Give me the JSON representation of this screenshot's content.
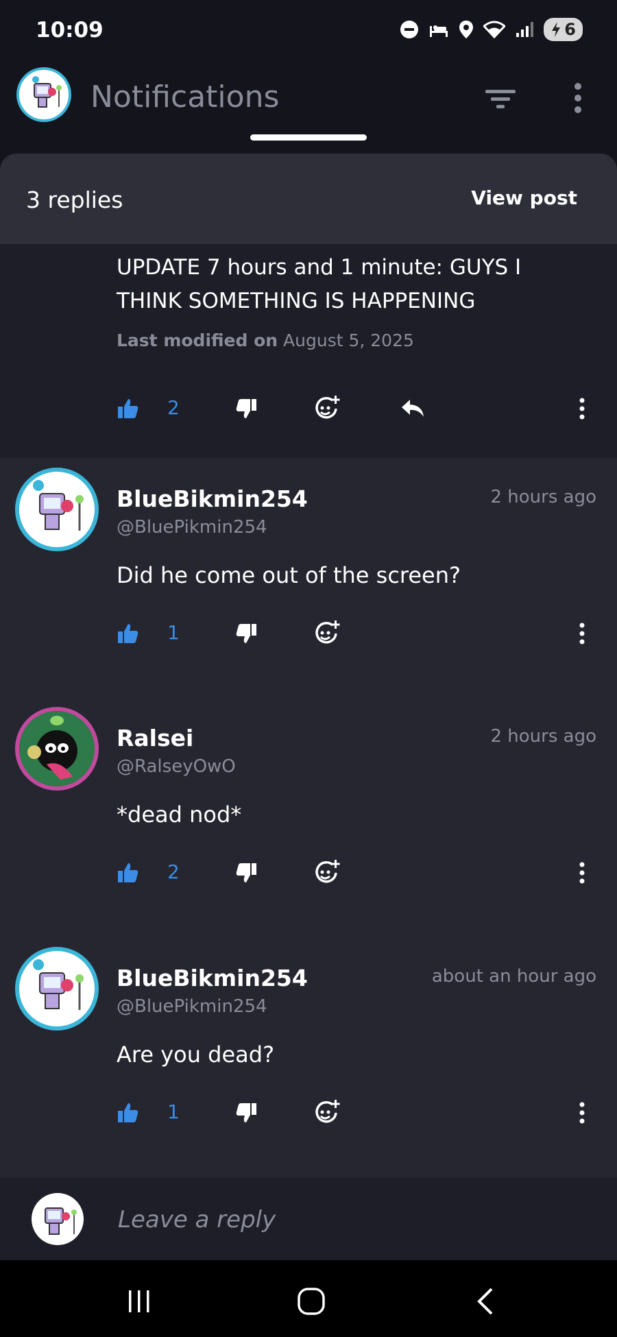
{
  "status_bar": {
    "time": "10:09",
    "battery": "6",
    "icons": [
      "do-not-disturb-icon",
      "bed-icon",
      "location-icon",
      "wifi-icon",
      "signal-icon",
      "battery-charging-icon"
    ]
  },
  "app_bar": {
    "title": "Notifications",
    "icons": [
      "avatar",
      "filter-icon",
      "more-vert-icon"
    ]
  },
  "sheet": {
    "replies_count": "3 replies",
    "view_post": "View post"
  },
  "parent_post": {
    "text": "UPDATE 7 hours and 1 minute: GUYS I THINK SOMETHING IS HAPPENING",
    "modified_label": "Last modified on",
    "modified_date": "August 5, 2025",
    "likes": "2"
  },
  "comments": [
    {
      "name": "BlueBikmin254",
      "handle": "@BluePikmin254",
      "time": "2 hours ago",
      "text": "Did he come out of the screen?",
      "likes": "1"
    },
    {
      "name": "Ralsei",
      "handle": "@RalseyOwO",
      "time": "2 hours ago",
      "text": "*dead nod*",
      "likes": "2"
    },
    {
      "name": "BlueBikmin254",
      "handle": "@BluePikmin254",
      "time": "about an hour ago",
      "text": "Are you dead?",
      "likes": "1"
    }
  ],
  "reply_bar": {
    "placeholder": "Leave a reply"
  },
  "colors": {
    "accent": "#3b8de6",
    "background": "#262631",
    "header": "#2e2f39",
    "muted": "#8a8d99"
  }
}
